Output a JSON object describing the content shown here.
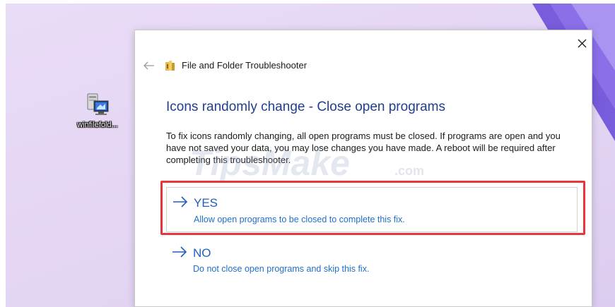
{
  "desktop": {
    "icon_label": "winfilefold..."
  },
  "dialog": {
    "app_title": "File and Folder Troubleshooter",
    "heading": "Icons randomly change - Close open programs",
    "description": "To fix icons randomly changing, all open programs must be closed. If programs are open and you have not saved your data, you may lose changes you have made. A reboot will be required after completing this troubleshooter.",
    "options": [
      {
        "title": "YES",
        "description": "Allow open programs to be closed to complete this fix."
      },
      {
        "title": "NO",
        "description": "Do not close open programs and skip this fix."
      }
    ]
  },
  "watermark": {
    "text": "TipsMake",
    "suffix": ".com"
  },
  "colors": {
    "heading": "#1f3f8f",
    "link": "#1f5fbf",
    "highlight": "#e8343a",
    "desktop": "#e4d6f4"
  },
  "icons": {
    "close": "close-icon",
    "back": "back-arrow-icon",
    "folder": "folder-icon",
    "option_arrow": "arrow-right-icon",
    "desktop_app": "application-icon"
  }
}
